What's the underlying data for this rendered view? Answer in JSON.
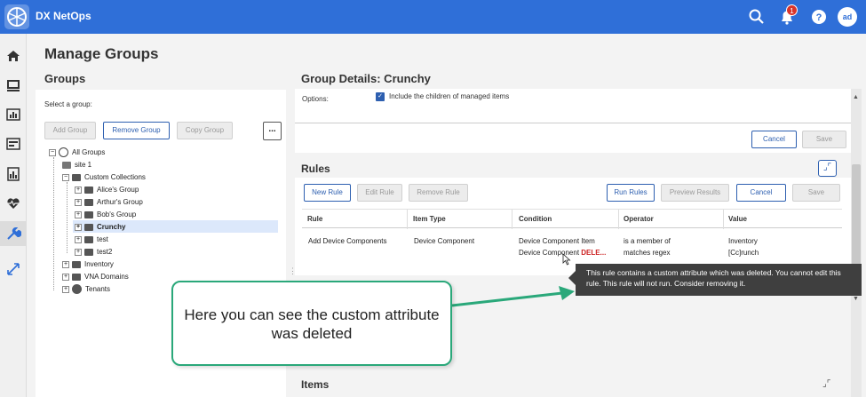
{
  "app": {
    "title": "DX NetOps",
    "notification_count": "1",
    "user_initials": "ad"
  },
  "page": {
    "title": "Manage Groups"
  },
  "groups": {
    "title": "Groups",
    "select_label": "Select a group:",
    "buttons": {
      "add": "Add Group",
      "remove": "Remove Group",
      "copy": "Copy Group",
      "more": "..."
    },
    "tree": {
      "all_groups": "All Groups",
      "site1": "site 1",
      "custom_collections": "Custom Collections",
      "alices_group": "Alice's Group",
      "arthurs_group": "Arthur's Group",
      "bobs_group": "Bob's Group",
      "crunchy": "Crunchy",
      "test": "test",
      "test2": "test2",
      "inventory": "Inventory",
      "vna_domains": "VNA Domains",
      "tenants": "Tenants"
    }
  },
  "details": {
    "title": "Group Details: Crunchy",
    "options_label": "Options:",
    "include_children": "Include the children of managed items",
    "cancel": "Cancel",
    "save": "Save"
  },
  "rules": {
    "title": "Rules",
    "buttons": {
      "new": "New Rule",
      "edit": "Edit Rule",
      "remove": "Remove Rule",
      "run": "Run Rules",
      "preview": "Preview Results",
      "cancel": "Cancel",
      "save": "Save"
    },
    "columns": [
      "Rule",
      "Item Type",
      "Condition",
      "Operator",
      "Value"
    ],
    "row": {
      "rule": "Add Device Components",
      "item_type": "Device Component",
      "condition_line1": "Device Component Item",
      "condition_line2": "Device Component",
      "condition_deleted": "DELE...",
      "operator_line1": "is a member of",
      "operator_line2": "matches regex",
      "value_line1": "Inventory",
      "value_line2": "[Cc]runch"
    }
  },
  "tooltip": {
    "text": "This rule contains a custom attribute which was deleted. You cannot edit this rule. This rule will not run. Consider removing it."
  },
  "callout": {
    "text": "Here you can see the custom attribute was deleted"
  },
  "items": {
    "title": "Items"
  },
  "colors": {
    "topbar": "#2f6fd8",
    "accent": "#2d5fb0",
    "callout_border": "#2aa87a",
    "deleted": "#cc2222",
    "tooltip_bg": "#3f3f3f"
  }
}
